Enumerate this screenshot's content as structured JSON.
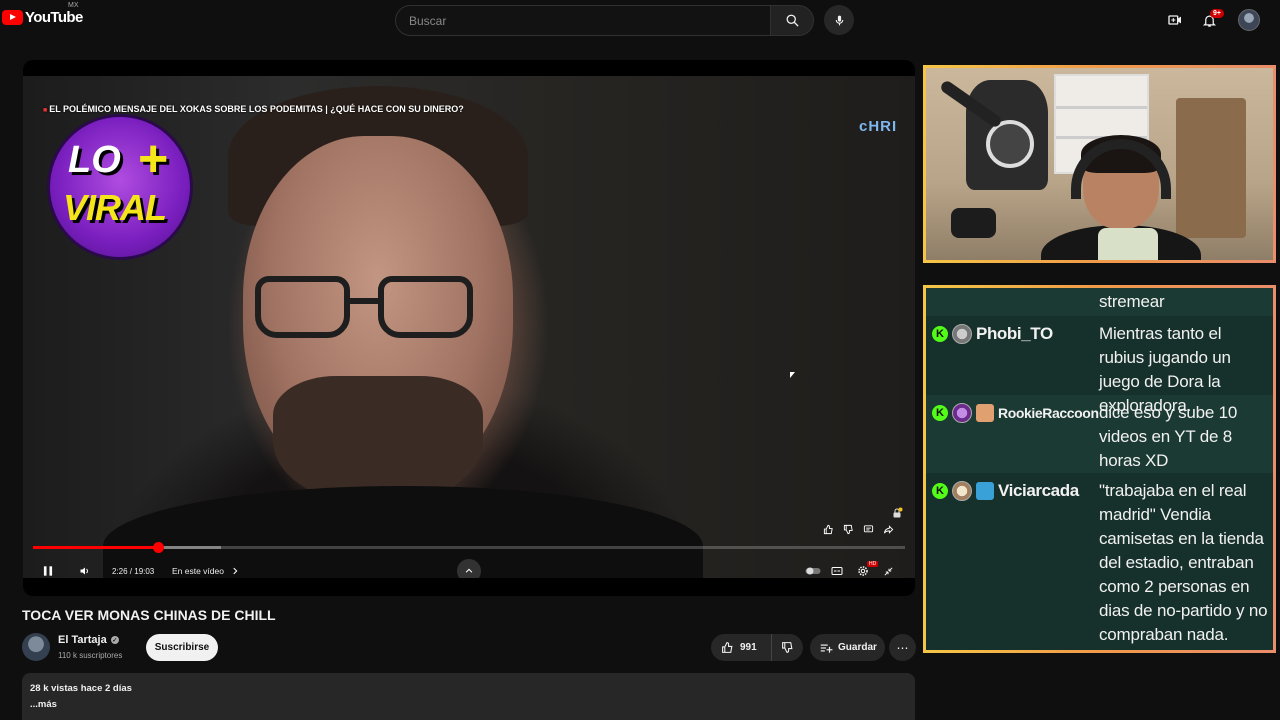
{
  "masthead": {
    "logo_text": "YouTube",
    "country_code": "MX",
    "search_placeholder": "Buscar",
    "notification_count": "9+"
  },
  "player": {
    "overlay_title": "EL POLÉMICO MENSAJE DEL XOKAS SOBRE LOS PODEMITAS | ¿QUÉ HACE CON SU DINERO?",
    "badge_lo": "LO",
    "badge_plus": "+",
    "badge_viral": "VIRAL",
    "corner_text": "cHRI",
    "time_display": "2:26 / 19:03",
    "chapter_label": "En este vídeo",
    "progress_played_fraction": 0.143,
    "progress_loaded_fraction": 0.216,
    "hd_badge": "HD",
    "accent_color": "#ff0000"
  },
  "video": {
    "title": "TOCA VER MONAS CHINAS DE CHILL",
    "channel_name": "El Tartaja",
    "verified_mark": "✓",
    "subscribers": "110 k suscriptores",
    "subscribe_label": "Suscribirse",
    "like_count": "991",
    "save_label": "Guardar",
    "more_symbol": "⋯",
    "description": {
      "meta": "28 k vistas  hace 2 días",
      "more_label": "...más"
    }
  },
  "chat": {
    "badge_letter": "K",
    "badge_color": "#53fc18",
    "frame_colors": [
      "#f5c646",
      "#f09a4a",
      "#e98d6b"
    ],
    "messages": [
      {
        "user": "",
        "text": "stremear"
      },
      {
        "user": "Phobi_TO",
        "text": "Mientras tanto el rubius jugando un juego de Dora la exploradora."
      },
      {
        "user": "RookieRaccoon",
        "text": "dice eso y sube 10 videos en YT de 8 horas XD"
      },
      {
        "user": "Viciarcada",
        "text": "\"trabajaba en el real madrid\" Vendia camisetas en la tienda del estadio, entraban como 2 personas en dias de no-partido y no compraban nada."
      }
    ]
  }
}
